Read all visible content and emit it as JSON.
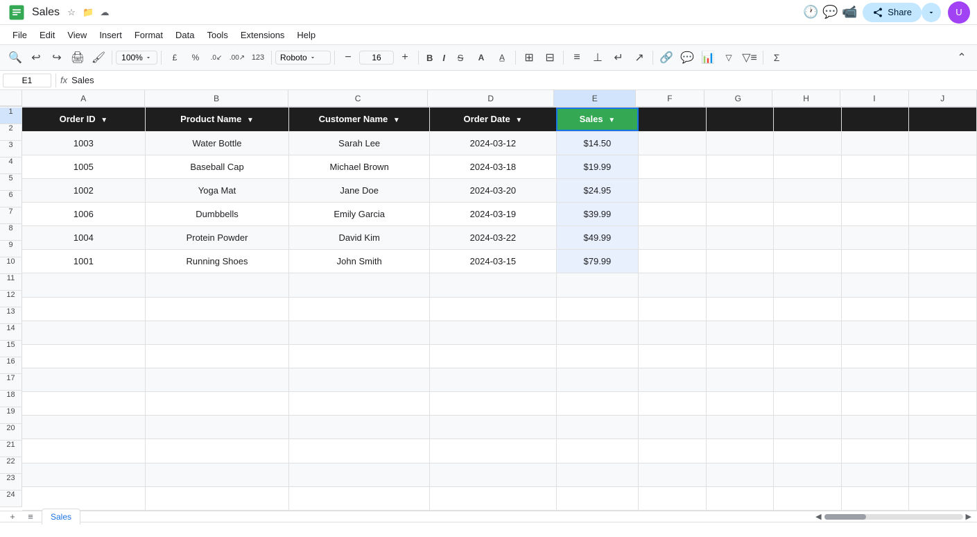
{
  "title": "Sales",
  "formula_bar": {
    "cell_ref": "E1",
    "formula": "Sales"
  },
  "menu": {
    "items": [
      "File",
      "Edit",
      "View",
      "Insert",
      "Format",
      "Data",
      "Tools",
      "Extensions",
      "Help"
    ]
  },
  "toolbar": {
    "zoom": "100%",
    "font": "Roboto",
    "font_size": "16",
    "bold_label": "B",
    "italic_label": "I"
  },
  "columns": {
    "headers": [
      "",
      "A",
      "B",
      "C",
      "D",
      "E",
      "F",
      "G",
      "H",
      "I",
      "J"
    ],
    "col_letters": [
      "A",
      "B",
      "C",
      "D",
      "E",
      "F",
      "G",
      "H",
      "I",
      "J"
    ]
  },
  "header_row": {
    "order_id": "Order ID",
    "product_name": "Product Name",
    "customer_name": "Customer Name",
    "order_date": "Order Date",
    "sales": "Sales"
  },
  "data_rows": [
    {
      "row_num": "2",
      "order_id": "1003",
      "product_name": "Water Bottle",
      "customer_name": "Sarah Lee",
      "order_date": "2024-03-12",
      "sales": "$14.50"
    },
    {
      "row_num": "3",
      "order_id": "1005",
      "product_name": "Baseball Cap",
      "customer_name": "Michael Brown",
      "order_date": "2024-03-18",
      "sales": "$19.99"
    },
    {
      "row_num": "4",
      "order_id": "1002",
      "product_name": "Yoga Mat",
      "customer_name": "Jane Doe",
      "order_date": "2024-03-20",
      "sales": "$24.95"
    },
    {
      "row_num": "5",
      "order_id": "1006",
      "product_name": "Dumbbells",
      "customer_name": "Emily Garcia",
      "order_date": "2024-03-19",
      "sales": "$39.99"
    },
    {
      "row_num": "6",
      "order_id": "1004",
      "product_name": "Protein Powder",
      "customer_name": "David Kim",
      "order_date": "2024-03-22",
      "sales": "$49.99"
    },
    {
      "row_num": "7",
      "order_id": "1001",
      "product_name": "Running Shoes",
      "customer_name": "John Smith",
      "order_date": "2024-03-15",
      "sales": "$79.99"
    }
  ],
  "empty_rows": [
    "8",
    "9",
    "10",
    "11",
    "12",
    "13",
    "14",
    "15",
    "16",
    "17",
    "18",
    "19",
    "20",
    "21",
    "22",
    "23",
    "24"
  ],
  "share_label": "Share",
  "sheet_tab": "Sales",
  "colors": {
    "header_bg": "#1e1e1e",
    "header_e_bg": "#34a853",
    "selected_col_bg": "#1a73e8",
    "active_cell_outline": "#1a73e8"
  }
}
